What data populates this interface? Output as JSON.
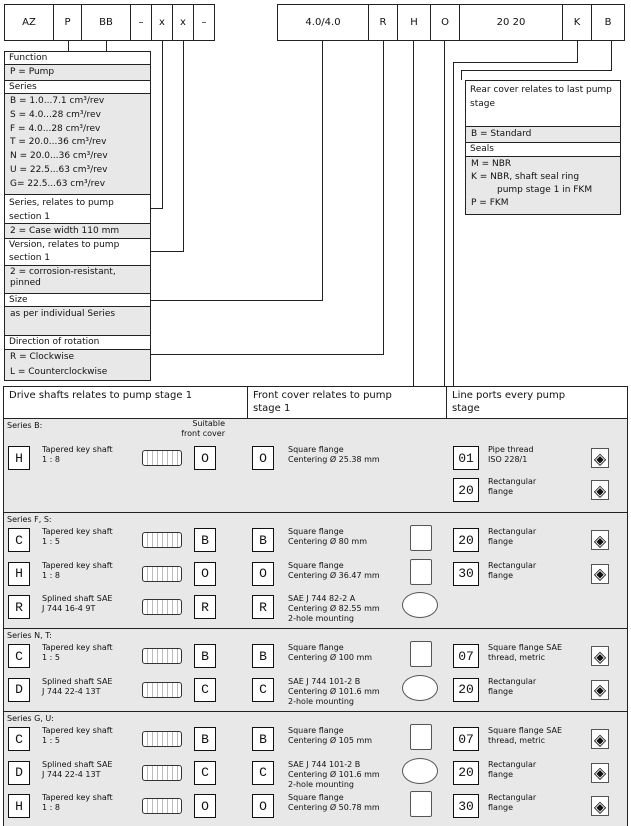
{
  "codes": {
    "c1": "AZ",
    "c2": "P",
    "c3": "BB",
    "c4": "–",
    "c5": "x",
    "c6": "x",
    "c7": "–",
    "c8": "4.0/4.0",
    "c9": "R",
    "c10": "H",
    "c11": "O",
    "c12": "20 20",
    "c13": "K",
    "c14": "B"
  },
  "left": {
    "function_h": "Function",
    "function_v": "P = Pump",
    "series_h": "Series",
    "series_v": [
      "B = 1.0...7.1 cm³/rev",
      "S = 4.0...28 cm³/rev",
      "F = 4.0...28 cm³/rev",
      "T = 20.0...36 cm³/rev",
      "N = 20.0...36 cm³/rev",
      "U = 22.5...63 cm³/rev",
      "G= 22.5...63 cm³/rev"
    ],
    "series_rel_h": "Series, relates to pump section 1",
    "series_rel_v": "2 = Case width 110 mm",
    "version_h": "Version, relates to pump section 1",
    "version_v": "2 = corrosion-resistant, pinned",
    "size_h": "Size",
    "size_v": "as per individual Series",
    "rot_h": "Direction of rotation",
    "rot_r": "R = Clockwise",
    "rot_l": "L = Counterclockwise"
  },
  "right": {
    "rear_h": "Rear cover relates to last pump stage",
    "rear_v": "B = Standard",
    "seals_h": "Seals",
    "seals_v": [
      "M = NBR",
      "K = NBR, shaft seal ring",
      "pump stage 1 in FKM",
      "P = FKM"
    ]
  },
  "cols": {
    "drive": "Drive shafts relates to pump stage 1",
    "front": "Front cover relates to pump stage 1",
    "ports": "Line ports every pump stage",
    "suitable": "Suitable front cover"
  },
  "sections": [
    {
      "label": "Series B:",
      "drive": [
        {
          "code": "H",
          "text": [
            "Tapered key shaft",
            "1 : 8"
          ],
          "fc": "O"
        }
      ],
      "front": [
        {
          "code": "O",
          "text": [
            "Square flange",
            "Centering Ø 25.38 mm"
          ]
        }
      ],
      "ports": [
        {
          "code": "01",
          "text": [
            "Pipe thread",
            "ISO 228/1"
          ]
        },
        {
          "code": "20",
          "text": [
            "Rectangular",
            "flange"
          ]
        }
      ]
    },
    {
      "label": "Series F, S:",
      "drive": [
        {
          "code": "C",
          "text": [
            "Tapered key shaft",
            "1 : 5"
          ],
          "fc": "B"
        },
        {
          "code": "H",
          "text": [
            "Tapered key shaft",
            "1 : 8"
          ],
          "fc": "O"
        },
        {
          "code": "R",
          "text": [
            "Splined shaft SAE",
            "J 744 16-4 9T"
          ],
          "fc": "R"
        }
      ],
      "front": [
        {
          "code": "B",
          "text": [
            "Square flange",
            "Centering Ø 80 mm"
          ]
        },
        {
          "code": "O",
          "text": [
            "Square flange",
            "Centering Ø 36.47 mm"
          ]
        },
        {
          "code": "R",
          "text": [
            "SAE J 744 82-2 A",
            "Centering Ø 82.55 mm",
            "2-hole mounting"
          ]
        }
      ],
      "ports": [
        {
          "code": "20",
          "text": [
            "Rectangular",
            "flange"
          ]
        },
        {
          "code": "30",
          "text": [
            "Rectangular",
            "flange"
          ]
        }
      ]
    },
    {
      "label": "Series N, T:",
      "drive": [
        {
          "code": "C",
          "text": [
            "Tapered key shaft",
            "1 : 5"
          ],
          "fc": "B"
        },
        {
          "code": "D",
          "text": [
            "Splined shaft SAE",
            "J 744 22-4 13T"
          ],
          "fc": "C"
        }
      ],
      "front": [
        {
          "code": "B",
          "text": [
            "Square flange",
            "Centering Ø 100 mm"
          ]
        },
        {
          "code": "C",
          "text": [
            "SAE J 744 101-2 B",
            "Centering Ø 101.6 mm",
            "2-hole mounting"
          ]
        }
      ],
      "ports": [
        {
          "code": "07",
          "text": [
            "Square flange SAE",
            "thread, metric"
          ]
        },
        {
          "code": "20",
          "text": [
            "Rectangular",
            "flange"
          ]
        }
      ]
    },
    {
      "label": "Series G, U:",
      "drive": [
        {
          "code": "C",
          "text": [
            "Tapered key shaft",
            "1 : 5"
          ],
          "fc": "B"
        },
        {
          "code": "D",
          "text": [
            "Splined shaft SAE",
            "J 744 22-4 13T"
          ],
          "fc": "C"
        },
        {
          "code": "H",
          "text": [
            "Tapered key shaft",
            "1 : 8"
          ],
          "fc": "O"
        }
      ],
      "front": [
        {
          "code": "B",
          "text": [
            "Square flange",
            "Centering Ø 105 mm"
          ]
        },
        {
          "code": "C",
          "text": [
            "SAE J 744 101-2 B",
            "Centering Ø 101.6 mm",
            "2-hole mounting"
          ]
        },
        {
          "code": "O",
          "text": [
            "Square flange",
            "Centering Ø 50.78 mm"
          ]
        }
      ],
      "ports": [
        {
          "code": "07",
          "text": [
            "Square flange SAE",
            "thread, metric"
          ]
        },
        {
          "code": "20",
          "text": [
            "Rectangular",
            "flange"
          ]
        },
        {
          "code": "30",
          "text": [
            "Rectangular",
            "flange"
          ]
        }
      ]
    }
  ]
}
